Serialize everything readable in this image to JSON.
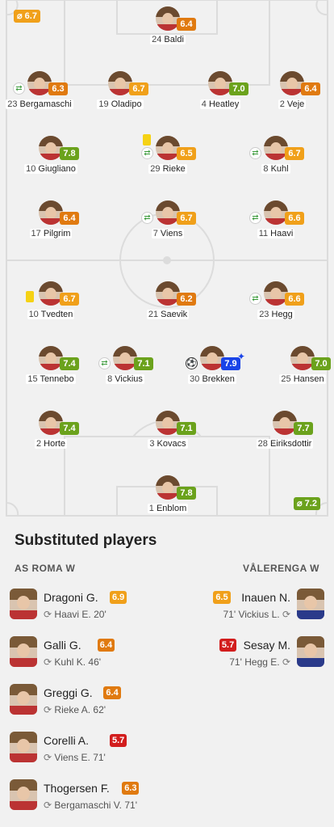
{
  "pitch": {
    "home_avg": "⌀ 6.7",
    "away_avg": "⌀ 7.2"
  },
  "players": [
    {
      "num": "24",
      "name": "Baldi",
      "rating": "6.4",
      "color": "orange"
    },
    {
      "num": "23",
      "name": "Bergamaschi",
      "rating": "6.3",
      "color": "orange",
      "sub": true
    },
    {
      "num": "19",
      "name": "Oladipo",
      "rating": "6.7",
      "color": "amber"
    },
    {
      "num": "4",
      "name": "Heatley",
      "rating": "7.0",
      "color": "green"
    },
    {
      "num": "2",
      "name": "Veje",
      "rating": "6.4",
      "color": "orange"
    },
    {
      "num": "10",
      "name": "Giugliano",
      "rating": "7.8",
      "color": "green"
    },
    {
      "num": "29",
      "name": "Rieke",
      "rating": "6.5",
      "color": "amber",
      "sub": true,
      "card": true
    },
    {
      "num": "8",
      "name": "Kuhl",
      "rating": "6.7",
      "color": "amber",
      "sub": true
    },
    {
      "num": "17",
      "name": "Pilgrim",
      "rating": "6.4",
      "color": "orange"
    },
    {
      "num": "7",
      "name": "Viens",
      "rating": "6.7",
      "color": "amber",
      "sub": true
    },
    {
      "num": "11",
      "name": "Haavi",
      "rating": "6.6",
      "color": "amber",
      "sub": true
    },
    {
      "num": "10",
      "name": "Tvedten",
      "rating": "6.7",
      "color": "amber",
      "card": true
    },
    {
      "num": "21",
      "name": "Saevik",
      "rating": "6.2",
      "color": "orange"
    },
    {
      "num": "23",
      "name": "Hegg",
      "rating": "6.6",
      "color": "amber",
      "sub": true
    },
    {
      "num": "15",
      "name": "Tennebo",
      "rating": "7.4",
      "color": "green"
    },
    {
      "num": "8",
      "name": "Vickius",
      "rating": "7.1",
      "color": "green",
      "sub": true
    },
    {
      "num": "30",
      "name": "Brekken",
      "rating": "7.9",
      "color": "blue",
      "goal": true,
      "star": true
    },
    {
      "num": "25",
      "name": "Hansen",
      "rating": "7.0",
      "color": "green"
    },
    {
      "num": "2",
      "name": "Horte",
      "rating": "7.4",
      "color": "green"
    },
    {
      "num": "3",
      "name": "Kovacs",
      "rating": "7.1",
      "color": "green"
    },
    {
      "num": "28",
      "name": "Eiriksdottir",
      "rating": "7.7",
      "color": "green"
    },
    {
      "num": "1",
      "name": "Enblom",
      "rating": "7.8",
      "color": "green"
    }
  ],
  "subs": {
    "title": "Substituted players",
    "home_team": "AS ROMA W",
    "away_team": "VÅLERENGA W",
    "home": [
      {
        "name": "Dragoni G.",
        "rating": "6.9",
        "color": "amber",
        "detail": "Haavi E. 20'"
      },
      {
        "name": "Galli G.",
        "rating": "6.4",
        "color": "orange",
        "detail": "Kuhl K. 46'"
      },
      {
        "name": "Greggi G.",
        "rating": "6.4",
        "color": "orange",
        "detail": "Rieke A. 62'"
      },
      {
        "name": "Corelli A.",
        "rating": "5.7",
        "color": "red",
        "detail": "Viens E. 71'"
      },
      {
        "name": "Thogersen F.",
        "rating": "6.3",
        "color": "orange",
        "detail": "Bergamaschi V. 71'"
      }
    ],
    "away": [
      {
        "name": "Inauen N.",
        "rating": "6.5",
        "color": "amber",
        "detail": "71' Vickius L."
      },
      {
        "name": "Sesay M.",
        "rating": "5.7",
        "color": "red",
        "detail": "71' Hegg E."
      }
    ]
  },
  "colors": {
    "green": "#6ba21c",
    "orange": "#e07a10",
    "amber": "#f0a01a",
    "blue": "#1a44e8",
    "red": "#d21d1d",
    "pitch_line": "#dcdcdc",
    "background": "#f1f1f1"
  },
  "icons": {
    "substitution": "swap-icon",
    "card": "yellow-card-icon",
    "goal": "football-icon",
    "star": "star-icon"
  }
}
